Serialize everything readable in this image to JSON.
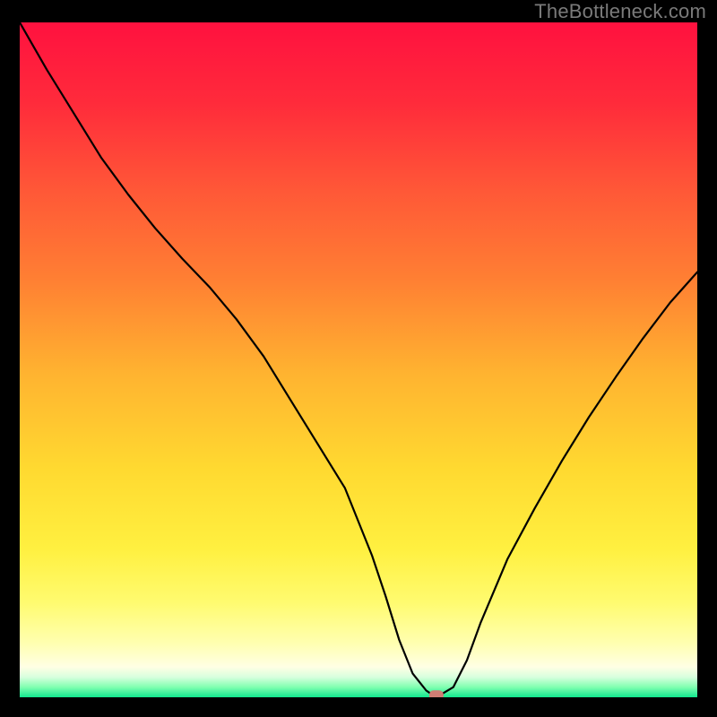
{
  "watermark": "TheBottleneck.com",
  "chart_data": {
    "type": "line",
    "title": "",
    "xlabel": "",
    "ylabel": "",
    "xlim": [
      0,
      100
    ],
    "ylim": [
      0,
      100
    ],
    "grid": false,
    "legend": false,
    "background_gradient": {
      "stops": [
        {
          "pos": 0.0,
          "color": "#ff113f"
        },
        {
          "pos": 0.12,
          "color": "#ff2b3b"
        },
        {
          "pos": 0.25,
          "color": "#ff5837"
        },
        {
          "pos": 0.38,
          "color": "#ff7f33"
        },
        {
          "pos": 0.52,
          "color": "#ffb330"
        },
        {
          "pos": 0.66,
          "color": "#ffd930"
        },
        {
          "pos": 0.78,
          "color": "#fff040"
        },
        {
          "pos": 0.86,
          "color": "#fffb70"
        },
        {
          "pos": 0.92,
          "color": "#ffffb0"
        },
        {
          "pos": 0.955,
          "color": "#ffffe4"
        },
        {
          "pos": 0.97,
          "color": "#d8ffde"
        },
        {
          "pos": 0.985,
          "color": "#80ffb0"
        },
        {
          "pos": 1.0,
          "color": "#11e88e"
        }
      ]
    },
    "series": [
      {
        "name": "bottleneck-curve",
        "color": "#000000",
        "x": [
          0,
          4,
          8,
          12,
          16,
          20,
          24,
          28,
          32,
          36,
          40,
          44,
          48,
          52,
          54,
          56,
          58,
          60,
          61,
          62,
          64,
          66,
          68,
          72,
          76,
          80,
          84,
          88,
          92,
          96,
          100
        ],
        "y": [
          100,
          93,
          86.5,
          80,
          74.5,
          69.5,
          65,
          60.8,
          56,
          50.5,
          44,
          37.5,
          31,
          21,
          15,
          8.5,
          3.5,
          1.0,
          0.3,
          0.3,
          1.5,
          5.5,
          11,
          20.5,
          28,
          35,
          41.5,
          47.5,
          53.2,
          58.5,
          63
        ]
      }
    ],
    "marker": {
      "name": "optimum-marker",
      "x": 61.5,
      "y": 0.3,
      "color": "#d07d74"
    }
  }
}
